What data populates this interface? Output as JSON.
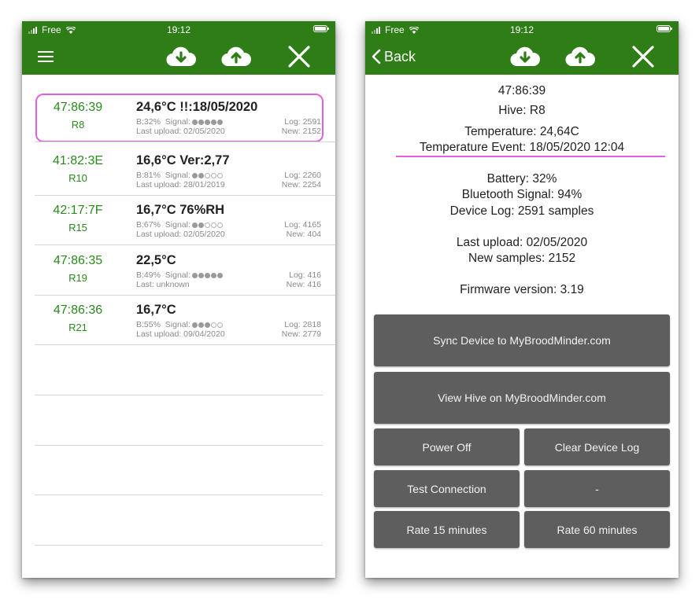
{
  "status": {
    "carrier": "Free",
    "time": "19:12"
  },
  "left": {
    "rows": [
      {
        "id": "47:86:39",
        "hive": "R8",
        "main": "24,6°C  !!:18/05/2020",
        "battery": "B:32%",
        "signal_label": "Signal:",
        "signal_level": 5,
        "upload": "Last upload: 02/05/2020",
        "log": "Log: 2591",
        "new": "New: 2152"
      },
      {
        "id": "41:82:3E",
        "hive": "R10",
        "main": "16,6°C Ver:2,77",
        "battery": "B:81%",
        "signal_label": "Signal:",
        "signal_level": 2,
        "upload": "Last upload: 28/01/2019",
        "log": "Log: 2260",
        "new": "New: 2254"
      },
      {
        "id": "42:17:7F",
        "hive": "R15",
        "main": "16,7°C 76%RH",
        "battery": "B:67%",
        "signal_label": "Signal:",
        "signal_level": 2,
        "upload": "Last upload: 02/05/2020",
        "log": "Log: 4165",
        "new": "New: 404"
      },
      {
        "id": "47:86:35",
        "hive": "R19",
        "main": "22,5°C",
        "battery": "B:49%",
        "signal_label": "Signal:",
        "signal_level": 5,
        "upload": "Last: unknown",
        "log": "Log: 416",
        "new": "New: 416"
      },
      {
        "id": "47:86:36",
        "hive": "R21",
        "main": "16,7°C",
        "battery": "B:55%",
        "signal_label": "Signal:",
        "signal_level": 3,
        "upload": "Last upload: 09/04/2020",
        "log": "Log: 2818",
        "new": "New: 2779"
      }
    ]
  },
  "right": {
    "back_label": "Back",
    "device_id": "47:86:39",
    "hive": "Hive: R8",
    "temperature": "Temperature: 24,64C",
    "temperature_event": "Temperature Event: 18/05/2020 12:04",
    "battery": "Battery: 32%",
    "bluetooth": "Bluetooth Signal: 94%",
    "device_log": "Device Log: 2591 samples",
    "last_upload": "Last upload: 02/05/2020",
    "new_samples": "New samples: 2152",
    "firmware": "Firmware version: 3.19",
    "buttons": {
      "sync": "Sync Device to MyBroodMinder.com",
      "view": "View Hive on MyBroodMinder.com",
      "power_off": "Power Off",
      "clear_log": "Clear Device Log",
      "test_connection": "Test Connection",
      "dash": "-",
      "rate15": "Rate 15 minutes",
      "rate60": "Rate 60 minutes"
    }
  },
  "icons": [
    "menu-icon",
    "cloud-download-icon",
    "cloud-upload-icon",
    "close-icon",
    "chevron-left-icon"
  ],
  "colors": {
    "header": "#2e7d16",
    "device_id": "#2a8a1c",
    "highlight": "#e060e0",
    "button": "#5e5e5e"
  }
}
